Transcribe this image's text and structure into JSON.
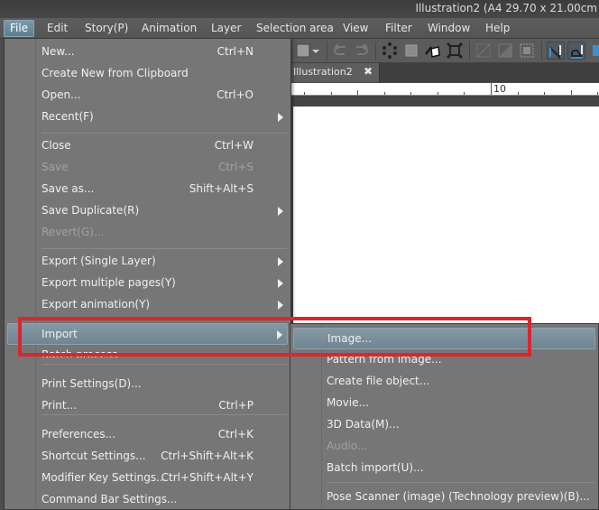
{
  "window": {
    "title": "Illustration2 (A4 29.70 x 21.00cm"
  },
  "menubar": {
    "items": [
      {
        "label": "File",
        "active": true
      },
      {
        "label": "Edit"
      },
      {
        "label": "Story(P)"
      },
      {
        "label": "Animation"
      },
      {
        "label": "Layer"
      },
      {
        "label": "Selection area"
      },
      {
        "label": "View"
      },
      {
        "label": "Filter"
      },
      {
        "label": "Window"
      },
      {
        "label": "Help"
      }
    ]
  },
  "toolbar": {
    "icons": [
      "color-swatch-icon",
      "dropdown-arrow-icon",
      "undo-icon",
      "redo-icon",
      "dots-icon",
      "transform-icon",
      "fill-bucket-icon",
      "expand-selection-icon",
      "clear-selection-icon",
      "gradient-icon",
      "selection-border-icon",
      "ruler-pen-icon",
      "ruler-curve-icon"
    ]
  },
  "document_tab": {
    "label": "Illustration2",
    "close": "✖"
  },
  "ruler": {
    "label": "10"
  },
  "file_menu": {
    "items": [
      {
        "label": "New...",
        "shortcut": "Ctrl+N"
      },
      {
        "label": "Create New from Clipboard",
        "shortcut": ""
      },
      {
        "label": "Open...",
        "shortcut": "Ctrl+O"
      },
      {
        "label": "Recent(F)",
        "shortcut": "",
        "submenu": true
      },
      {
        "label": "Close",
        "shortcut": "Ctrl+W"
      },
      {
        "label": "Save",
        "shortcut": "Ctrl+S",
        "disabled": true
      },
      {
        "label": "Save as...",
        "shortcut": "Shift+Alt+S"
      },
      {
        "label": "Save Duplicate(R)",
        "shortcut": "",
        "submenu": true
      },
      {
        "label": "Revert(G)...",
        "shortcut": "",
        "disabled": true
      },
      {
        "label": "Export (Single Layer)",
        "shortcut": "",
        "submenu": true
      },
      {
        "label": "Export multiple pages(Y)",
        "shortcut": "",
        "submenu": true
      },
      {
        "label": "Export animation(Y)",
        "shortcut": "",
        "submenu": true
      },
      {
        "label": "Import",
        "shortcut": "",
        "submenu": true,
        "highlighted": true
      },
      {
        "label": "Batch process",
        "shortcut": ""
      },
      {
        "label": "Print Settings(D)...",
        "shortcut": ""
      },
      {
        "label": "Print...",
        "shortcut": "Ctrl+P"
      },
      {
        "label": "Preferences...",
        "shortcut": "Ctrl+K"
      },
      {
        "label": "Shortcut Settings...",
        "shortcut": "Ctrl+Shift+Alt+K"
      },
      {
        "label": "Modifier Key Settings...",
        "shortcut": "Ctrl+Shift+Alt+Y"
      },
      {
        "label": "Command Bar Settings...",
        "shortcut": ""
      }
    ]
  },
  "import_submenu": {
    "items": [
      {
        "label": "Image...",
        "highlighted": true
      },
      {
        "label": "Pattern from image..."
      },
      {
        "label": "Create file object..."
      },
      {
        "label": "Movie..."
      },
      {
        "label": "3D Data(M)..."
      },
      {
        "label": "Audio...",
        "disabled": true
      },
      {
        "label": "Batch import(U)..."
      },
      {
        "label": "Pose Scanner (image) (Technology preview)(B)..."
      }
    ]
  },
  "annotation": {
    "color": "#d9272e",
    "target": "Import > Image..."
  }
}
